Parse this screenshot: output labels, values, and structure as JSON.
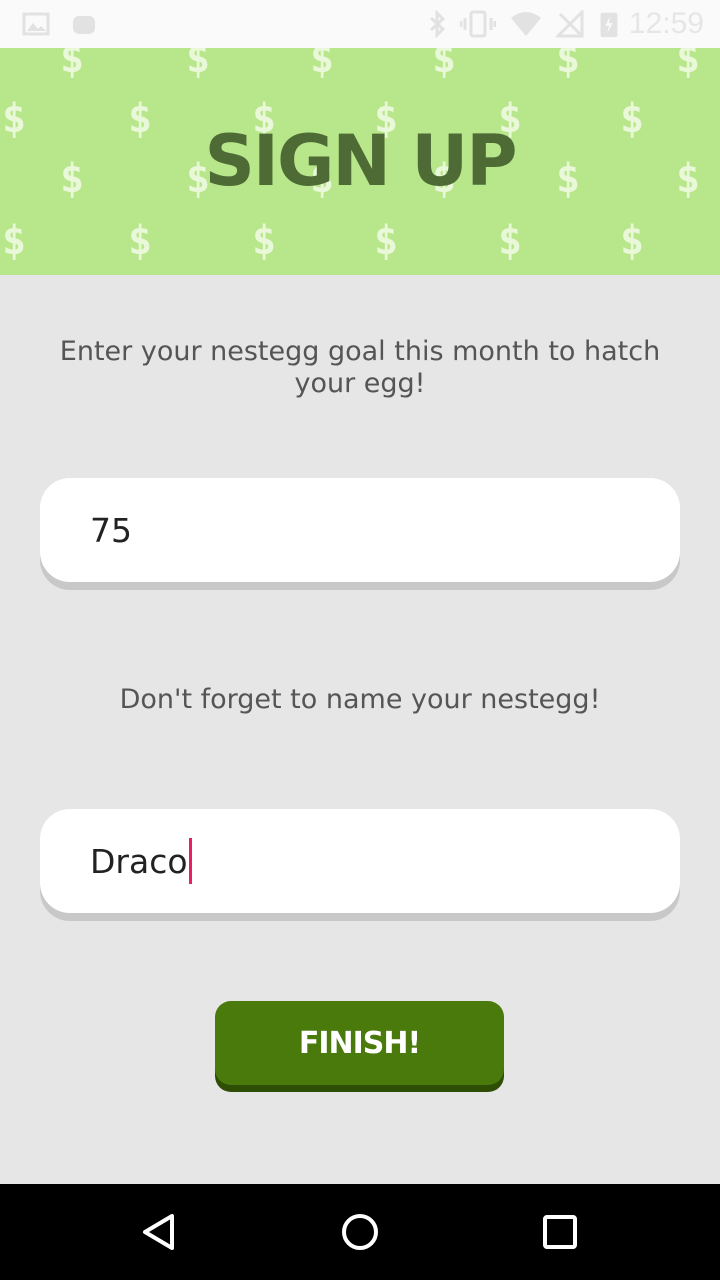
{
  "status_bar": {
    "time": "12:59",
    "icons": [
      "image-icon",
      "android-icon",
      "bluetooth-icon",
      "vibrate-icon",
      "wifi-icon",
      "no-signal-icon",
      "battery-charging-icon"
    ]
  },
  "header": {
    "title": "SIGN UP",
    "background_color": "#b8e68a",
    "pattern_glyph": "$"
  },
  "form": {
    "goal_prompt": "Enter your nestegg goal this month to hatch your egg!",
    "goal_value": "75",
    "name_prompt": "Don't forget to name your nestegg!",
    "name_value": "Draco",
    "finish_label": "FINISH!",
    "accent_color": "#4a7a0c",
    "cursor_color": "#e91e63"
  },
  "nav_bar": {
    "buttons": [
      "back-icon",
      "home-icon",
      "recents-icon"
    ]
  }
}
